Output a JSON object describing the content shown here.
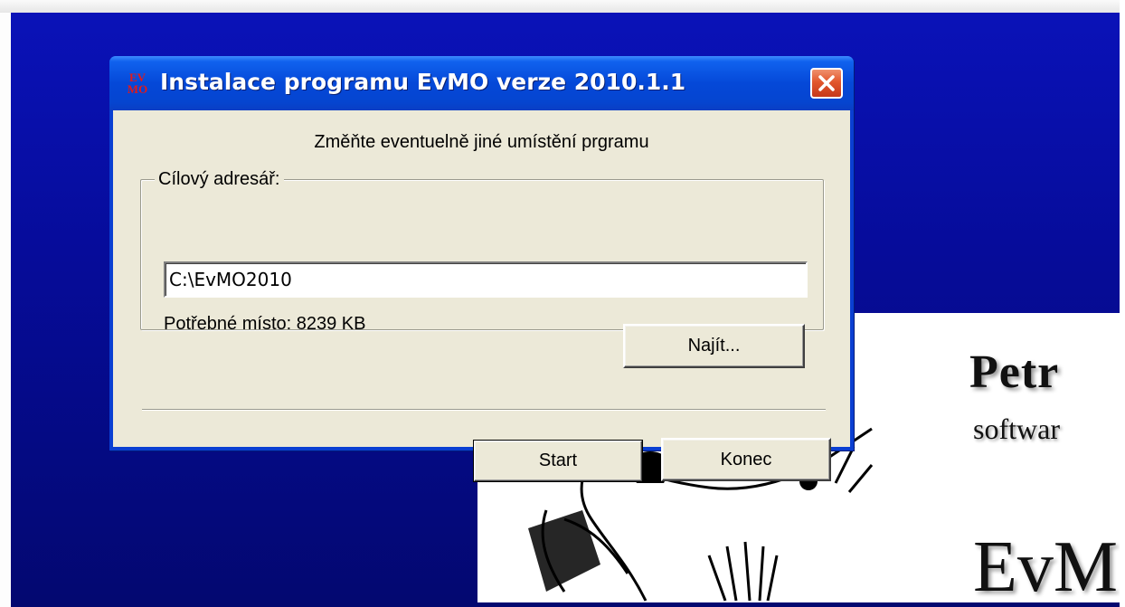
{
  "window": {
    "title": "Instalace programu EvMO verze 2010.1.1",
    "logo_line1": "EV",
    "logo_line2": "MO",
    "close_icon": "close-icon"
  },
  "dialog": {
    "instruction": "Změňte eventuelně jiné umístění prgramu",
    "group_label": "Cílový adresář:",
    "path_value": "C:\\EvMO2010",
    "required_space": "Potřebné místo: 8239 KB",
    "browse_label": "Najít...",
    "start_label": "Start",
    "exit_label": "Konec"
  },
  "splash": {
    "company": "Petr",
    "tagline": "softwar",
    "product": "EvM"
  },
  "colors": {
    "desktop_blue": "#060c9a",
    "titlebar_blue": "#0548d8",
    "dialog_face": "#ece9d8",
    "close_red": "#e2572d"
  }
}
